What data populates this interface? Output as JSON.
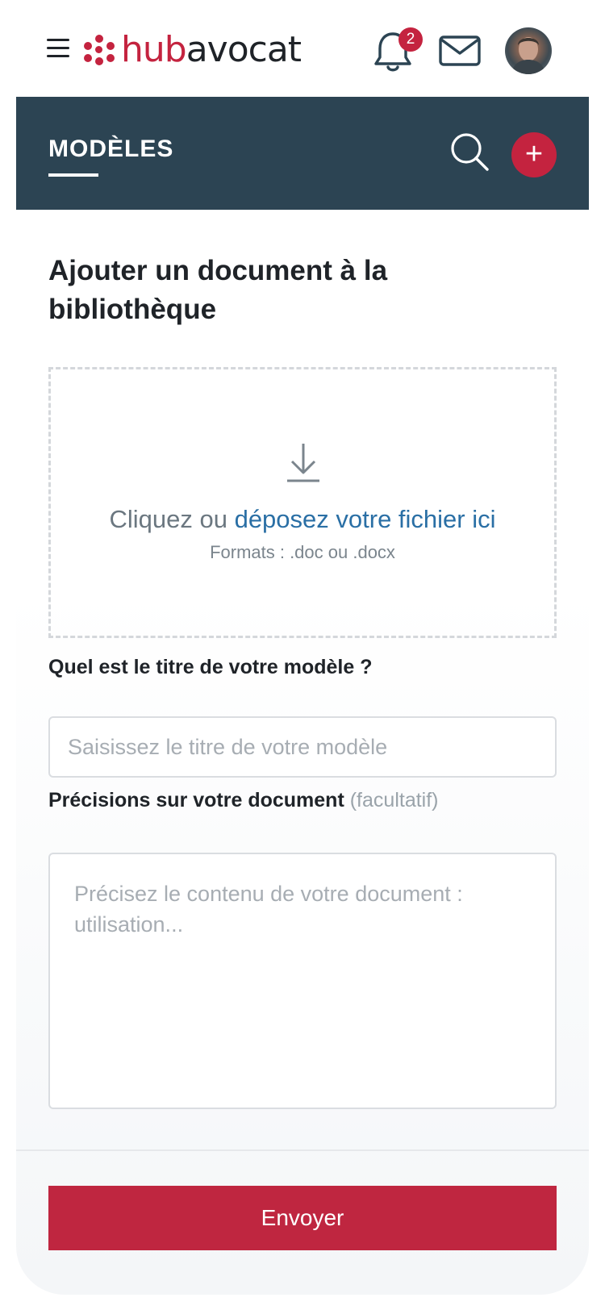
{
  "header": {
    "logo": {
      "part1": "hub",
      "part2": "avocat"
    },
    "notifications": {
      "count": "2"
    },
    "icons": {
      "menu": "hamburger-menu-icon",
      "bell": "bell-icon",
      "mail": "mail-icon",
      "avatar": "user-avatar"
    }
  },
  "section": {
    "title": "MODÈLES",
    "icons": {
      "search": "search-icon",
      "add": "plus-icon"
    },
    "add_symbol": "+"
  },
  "form": {
    "title": "Ajouter un document à la bibliothèque",
    "dropzone": {
      "prefix": "Cliquez ou ",
      "link": "déposez votre fichier ici",
      "formats": "Formats : .doc ou .docx"
    },
    "title_field": {
      "label": "Quel est le titre de votre modèle ?",
      "placeholder": "Saisissez le titre de votre modèle",
      "value": ""
    },
    "details_field": {
      "label": "Précisions sur votre document",
      "optional": "(facultatif)",
      "placeholder": "Précisez le contenu de votre document : utilisation...",
      "value": ""
    },
    "submit_label": "Envoyer"
  },
  "colors": {
    "brand": "#c4233f",
    "header_bg": "#2c4453",
    "link": "#2a6fa5",
    "button": "#bf2640"
  }
}
